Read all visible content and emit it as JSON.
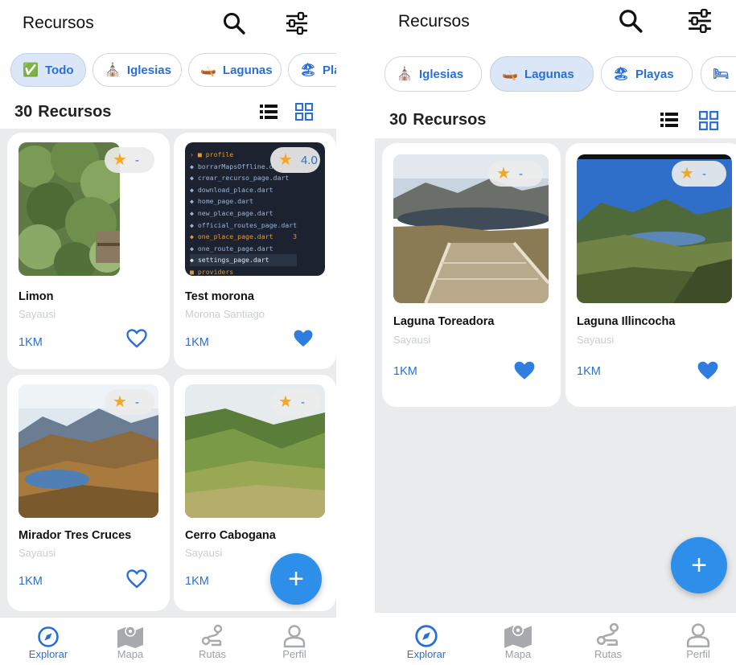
{
  "colors": {
    "accent": "#2a6fd6",
    "fab": "#2d8fe9",
    "star": "#f5a623",
    "grid_bg": "#e9ebed"
  },
  "left_screen": {
    "title": "Recursos",
    "chips": [
      {
        "emoji": "✅",
        "label": "Todo",
        "selected": true
      },
      {
        "emoji": "⛪",
        "label": "Iglesias",
        "selected": false
      },
      {
        "emoji": "🛶",
        "label": "Lagunas",
        "selected": false
      },
      {
        "emoji": "🏖",
        "label": "Playas",
        "selected": false
      }
    ],
    "count_number": "30",
    "count_label": "Recursos",
    "cards": [
      {
        "name": "Limon",
        "location": "Sayausi",
        "distance": "1KM",
        "rating": "-",
        "favorite": false,
        "image": "plant-photo"
      },
      {
        "name": "Test morona",
        "location": "Morona Santiago",
        "distance": "1KM",
        "rating": "4.0",
        "favorite": true,
        "image": "code-editor-screenshot",
        "code_lines": [
          "profile",
          "borrarMapsOffline.d",
          "crear_recurso_page.dart",
          "download_place.dart",
          "home_page.dart",
          "new_place_page.dart",
          "official_routes_page.dart",
          "one_place_page.dart",
          "one_route_page.dart",
          "settings_page.dart",
          "providers"
        ]
      },
      {
        "name": "Mirador Tres Cruces",
        "location": "Sayausi",
        "distance": "1KM",
        "rating": "-",
        "favorite": false,
        "image": "mountain-lake-photo"
      },
      {
        "name": "Cerro Cabogana",
        "location": "Sayausi",
        "distance": "1KM",
        "rating": "-",
        "favorite": false,
        "image": "green-hills-photo"
      }
    ],
    "fab_label": "+",
    "nav": [
      {
        "label": "Explorar",
        "icon": "compass-icon",
        "active": true
      },
      {
        "label": "Mapa",
        "icon": "map-icon",
        "active": false
      },
      {
        "label": "Rutas",
        "icon": "route-icon",
        "active": false
      },
      {
        "label": "Perfil",
        "icon": "person-icon",
        "active": false
      }
    ]
  },
  "right_screen": {
    "title": "Recursos",
    "chips": [
      {
        "emoji": "⛪",
        "label": "Iglesias",
        "selected": false
      },
      {
        "emoji": "🛶",
        "label": "Lagunas",
        "selected": true
      },
      {
        "emoji": "🏖",
        "label": "Playas",
        "selected": false
      },
      {
        "emoji": "🛏",
        "label": "",
        "selected": false
      }
    ],
    "count_number": "30",
    "count_label": "Recursos",
    "cards": [
      {
        "name": "Laguna Toreadora",
        "location": "Sayausi",
        "distance": "1KM",
        "rating": "-",
        "favorite": true,
        "image": "lake-boardwalk-photo"
      },
      {
        "name": "Laguna Illincocha",
        "location": "Sayausi",
        "distance": "1KM",
        "rating": "-",
        "favorite": true,
        "image": "blue-lake-photo"
      }
    ],
    "fab_label": "+",
    "nav": [
      {
        "label": "Explorar",
        "icon": "compass-icon",
        "active": true
      },
      {
        "label": "Mapa",
        "icon": "map-icon",
        "active": false
      },
      {
        "label": "Rutas",
        "icon": "route-icon",
        "active": false
      },
      {
        "label": "Perfil",
        "icon": "person-icon",
        "active": false
      }
    ]
  }
}
